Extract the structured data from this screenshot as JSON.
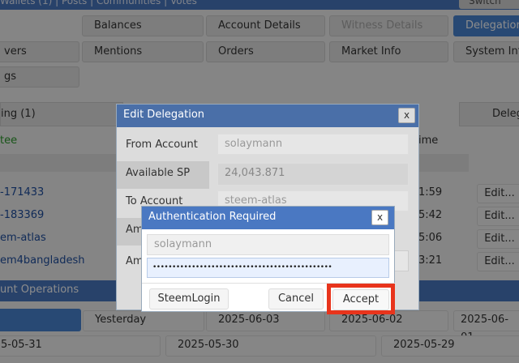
{
  "topbar": {
    "menu_text": "Wallets (1) | Posts | Communities | Votes",
    "right_button": "Switch"
  },
  "tabs": {
    "row1": [
      {
        "label": "Balances"
      },
      {
        "label": "Account Details"
      },
      {
        "label": "Witness Details"
      },
      {
        "label": "Delegations"
      }
    ],
    "row2": [
      {
        "label": "vers"
      },
      {
        "label": "Mentions"
      },
      {
        "label": "Orders"
      },
      {
        "label": "Market Info"
      },
      {
        "label": "System Info"
      }
    ],
    "row3": [
      {
        "label": "gs"
      }
    ]
  },
  "delegations": {
    "outgoing_tab": "ing (1)",
    "right_tab": "Deleg",
    "header_delegatee": "tee",
    "header_time": "ime",
    "rows": [
      {
        "delegatee": "-171433",
        "time": "1:59",
        "action": "Edit..."
      },
      {
        "delegatee": "-183369",
        "time": "5:42",
        "action": "Edit..."
      },
      {
        "delegatee": "em-atlas",
        "time": "5:06",
        "action": "Edit..."
      },
      {
        "delegatee": "em4bangladesh",
        "time": "3:21",
        "action": "Edit..."
      }
    ]
  },
  "operations": {
    "header": "unt Operations",
    "dates_row1": [
      "Yesterday",
      "2025-06-03",
      "2025-06-02",
      "2025-06-01"
    ],
    "dates_row2": [
      "5-05-31",
      "2025-05-30",
      "2025-05-29"
    ]
  },
  "edit_delegation": {
    "title": "Edit Delegation",
    "close": "x",
    "from_label": "From Account",
    "from_value": "solaymann",
    "available_label": "Available SP",
    "available_value": "24,043.871",
    "to_label": "To Account",
    "to_value": "steem-atlas",
    "amount_label_1": "Am",
    "amount_label_2": "Am"
  },
  "auth": {
    "title": "Authentication Required",
    "close": "x",
    "username": "solaymann",
    "password_mask": "••••••••••••••••••••••••••••••••••••••••••••••",
    "steemlogin": "SteemLogin",
    "cancel": "Cancel",
    "accept": "Accept"
  },
  "colors": {
    "title_bar": "#4a78c2",
    "accept_highlight": "#e8341c"
  }
}
